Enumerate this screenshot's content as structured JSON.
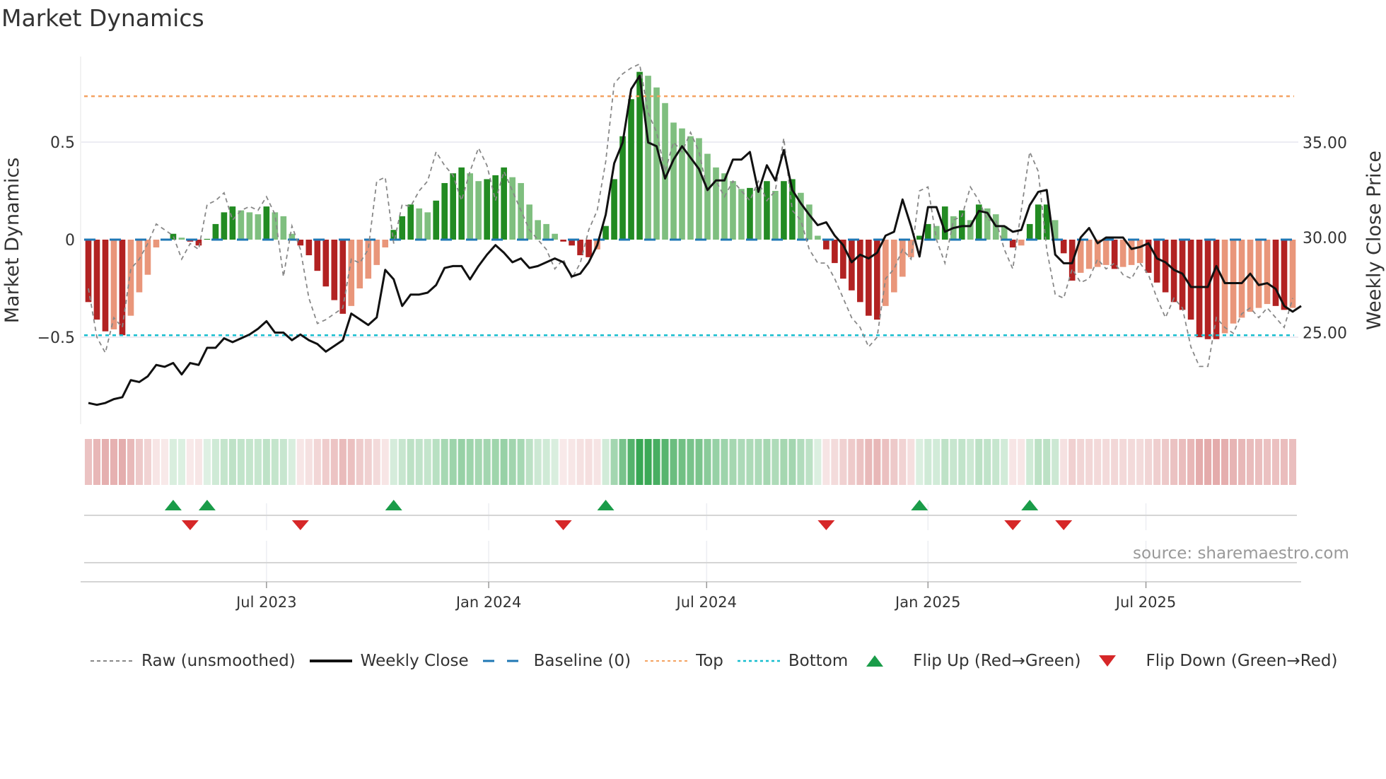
{
  "chart_data": {
    "type": "bar",
    "title": "Market Dynamics",
    "ylabel": "Market Dynamics",
    "y2label": "Weekly Close Price",
    "ylim": [
      -0.85,
      0.92
    ],
    "y2lim": [
      19.8,
      39.5
    ],
    "yticks": [
      {
        "value": 0.5,
        "label": "0.5"
      },
      {
        "value": 0,
        "label": "0"
      },
      {
        "value": -0.5,
        "label": "−0.5"
      }
    ],
    "y2ticks": [
      {
        "value": 35,
        "label": "35.00"
      },
      {
        "value": 30,
        "label": "30.00"
      },
      {
        "value": 25,
        "label": "25.00"
      }
    ],
    "xticks": [
      {
        "index": 21.0,
        "label": "Jul 2023"
      },
      {
        "index": 47.2,
        "label": "Jan 2024"
      },
      {
        "index": 72.9,
        "label": "Jul 2024"
      },
      {
        "index": 99.0,
        "label": "Jan 2025"
      },
      {
        "index": 124.7,
        "label": "Jul 2025"
      }
    ],
    "top_level": 0.735,
    "bottom_level": -0.49,
    "baseline": 0,
    "momentum": [
      -0.32,
      -0.41,
      -0.47,
      -0.46,
      -0.49,
      -0.39,
      -0.27,
      -0.18,
      -0.04,
      -0.005,
      0.03,
      0.01,
      -0.01,
      -0.03,
      0.004,
      0.08,
      0.14,
      0.17,
      0.15,
      0.14,
      0.13,
      0.17,
      0.14,
      0.12,
      0.03,
      -0.03,
      -0.08,
      -0.16,
      -0.24,
      -0.31,
      -0.38,
      -0.34,
      -0.25,
      -0.2,
      -0.13,
      -0.04,
      0.05,
      0.12,
      0.18,
      0.16,
      0.14,
      0.2,
      0.29,
      0.34,
      0.37,
      0.34,
      0.3,
      0.31,
      0.33,
      0.37,
      0.32,
      0.29,
      0.18,
      0.1,
      0.08,
      0.03,
      -0.01,
      -0.03,
      -0.08,
      -0.09,
      -0.05,
      0.07,
      0.31,
      0.53,
      0.72,
      0.86,
      0.84,
      0.78,
      0.7,
      0.6,
      0.57,
      0.53,
      0.52,
      0.44,
      0.37,
      0.34,
      0.3,
      0.26,
      0.265,
      0.26,
      0.3,
      0.25,
      0.3,
      0.31,
      0.24,
      0.18,
      0.02,
      -0.05,
      -0.12,
      -0.2,
      -0.26,
      -0.32,
      -0.39,
      -0.41,
      -0.34,
      -0.27,
      -0.19,
      -0.09,
      0.02,
      0.08,
      0.07,
      0.17,
      0.12,
      0.15,
      0.1,
      0.18,
      0.16,
      0.13,
      0.07,
      -0.04,
      -0.03,
      0.08,
      0.18,
      0.18,
      0.1,
      -0.07,
      -0.21,
      -0.17,
      -0.15,
      -0.14,
      -0.13,
      -0.15,
      -0.14,
      -0.13,
      -0.12,
      -0.17,
      -0.22,
      -0.27,
      -0.32,
      -0.36,
      -0.41,
      -0.5,
      -0.51,
      -0.51,
      -0.48,
      -0.43,
      -0.4,
      -0.37,
      -0.35,
      -0.33,
      -0.34,
      -0.36,
      -0.35
    ],
    "raw": [
      -0.25,
      -0.5,
      -0.58,
      -0.4,
      -0.45,
      -0.15,
      -0.1,
      -0.02,
      0.08,
      0.05,
      0.02,
      -0.1,
      -0.02,
      -0.05,
      0.18,
      0.2,
      0.24,
      0.1,
      0.15,
      0.17,
      0.15,
      0.22,
      0.13,
      -0.19,
      0.07,
      -0.05,
      -0.3,
      -0.43,
      -0.41,
      -0.38,
      -0.35,
      -0.1,
      -0.12,
      -0.05,
      0.3,
      0.32,
      -0.02,
      0.18,
      0.17,
      0.25,
      0.3,
      0.45,
      0.38,
      0.33,
      0.2,
      0.35,
      0.47,
      0.38,
      0.2,
      0.35,
      0.25,
      0.15,
      0.05,
      0.0,
      -0.05,
      -0.15,
      -0.1,
      -0.2,
      -0.12,
      0.05,
      0.15,
      0.4,
      0.8,
      0.85,
      0.88,
      0.9,
      0.65,
      0.55,
      0.35,
      0.5,
      0.45,
      0.55,
      0.45,
      0.25,
      0.3,
      0.22,
      0.3,
      0.25,
      0.2,
      0.3,
      0.2,
      0.25,
      0.52,
      0.15,
      0.1,
      -0.05,
      -0.12,
      -0.12,
      -0.2,
      -0.3,
      -0.4,
      -0.45,
      -0.55,
      -0.5,
      -0.2,
      -0.15,
      -0.05,
      -0.1,
      0.25,
      0.27,
      0.0,
      -0.12,
      0.1,
      0.12,
      0.27,
      0.2,
      0.1,
      0.1,
      -0.05,
      -0.15,
      0.15,
      0.45,
      0.35,
      -0.05,
      -0.28,
      -0.3,
      -0.15,
      -0.22,
      -0.2,
      -0.1,
      -0.15,
      -0.12,
      -0.18,
      -0.2,
      -0.12,
      -0.18,
      -0.3,
      -0.4,
      -0.3,
      -0.35,
      -0.55,
      -0.65,
      -0.65,
      -0.4,
      -0.45,
      -0.48,
      -0.38,
      -0.35,
      -0.4,
      -0.35,
      -0.4,
      -0.45,
      -0.3
    ],
    "price": [
      21.3,
      21.2,
      21.3,
      21.5,
      21.6,
      22.5,
      22.4,
      22.7,
      23.3,
      23.2,
      23.4,
      22.8,
      23.4,
      23.3,
      24.2,
      24.2,
      24.7,
      24.5,
      24.7,
      24.9,
      25.2,
      25.6,
      25.0,
      25.0,
      24.6,
      24.9,
      24.6,
      24.4,
      24.0,
      24.3,
      24.6,
      26.0,
      25.7,
      25.4,
      25.8,
      28.3,
      27.8,
      26.4,
      27.0,
      27.0,
      27.1,
      27.5,
      28.4,
      28.5,
      28.5,
      27.8,
      28.5,
      29.1,
      29.6,
      29.2,
      28.7,
      28.9,
      28.4,
      28.5,
      28.7,
      28.9,
      28.7,
      27.95,
      28.1,
      28.7,
      29.6,
      31.2,
      33.9,
      35.0,
      37.8,
      38.5,
      35.0,
      34.8,
      33.1,
      34.1,
      34.8,
      34.2,
      33.6,
      32.5,
      33.0,
      33.0,
      34.1,
      34.1,
      34.5,
      32.4,
      33.8,
      33.0,
      34.6,
      32.5,
      31.8,
      31.2,
      30.65,
      30.8,
      30.1,
      29.6,
      28.7,
      29.1,
      28.9,
      29.2,
      30.1,
      30.3,
      32.0,
      30.6,
      29.0,
      31.6,
      31.6,
      30.3,
      30.5,
      30.6,
      30.6,
      31.4,
      31.3,
      30.6,
      30.6,
      30.3,
      30.4,
      31.7,
      32.4,
      32.5,
      29.1,
      28.65,
      28.65,
      30.0,
      30.5,
      29.7,
      30.0,
      30.0,
      30.0,
      29.4,
      29.5,
      29.7,
      28.9,
      28.7,
      28.3,
      28.1,
      27.4,
      27.4,
      27.4,
      28.5,
      27.6,
      27.6,
      27.6,
      28.1,
      27.5,
      27.6,
      27.3,
      26.4,
      26.1,
      26.4
    ],
    "flip_up_indices": [
      10,
      14,
      36,
      61,
      98,
      111
    ],
    "flip_down_indices": [
      12,
      25,
      56,
      87,
      109,
      115
    ],
    "legend_placement": "bottom",
    "legend": {
      "raw": "Raw (unsmoothed)",
      "close": "Weekly Close",
      "baseline": "Baseline (0)",
      "top": "Top",
      "bottom": "Bottom",
      "flip_up": "Flip Up (Red→Green)",
      "flip_down": "Flip Down (Green→Red)"
    },
    "source": "source: sharemaestro.com"
  },
  "colors": {
    "green_dark": "#228b22",
    "green_light": "#7fbf7f",
    "red_dark": "#b22222",
    "red_light": "#e9967a",
    "baseline": "#1f77b4",
    "top": "#f4a261",
    "bottom": "#17becf",
    "flip_up": "#1a9c49",
    "flip_down": "#d62728",
    "price": "#111111",
    "raw": "#888888"
  }
}
